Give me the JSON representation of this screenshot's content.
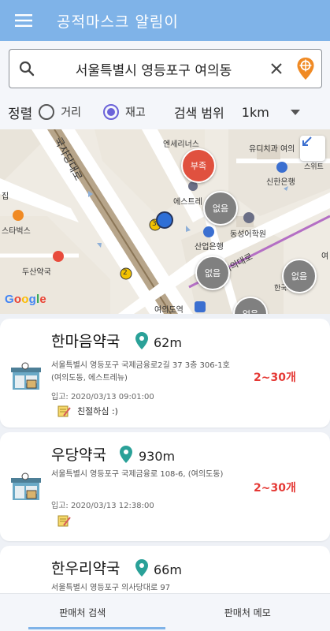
{
  "app": {
    "title": "공적마스크 알림이"
  },
  "colors": {
    "accent": "#7fb3e8",
    "radio_on": "#6c63d9",
    "stock_red": "#e53935",
    "empty_gray": "#808080",
    "low_red": "#e0513f",
    "pin_green": "#2aa198"
  },
  "search": {
    "value": "서울특별시 영등포구 여의동",
    "icon": "search-icon",
    "clear_icon": "close-icon",
    "location_icon": "location-pin-icon"
  },
  "filter": {
    "sort_label": "정렬",
    "options": [
      {
        "label": "거리",
        "selected": false
      },
      {
        "label": "재고",
        "selected": true
      }
    ],
    "radius_label": "검색 범위",
    "radius_value": "1km"
  },
  "map": {
    "labels": {
      "road1": "국사당대로",
      "road2": "여의대로",
      "enseries": "엔세리너스",
      "yudichi": "유디치과 여의",
      "suite": "스위트",
      "bank": "신한은행",
      "esteu": "에스트레",
      "dongseong": "동성어학원",
      "sanup": "산업은행",
      "starbucks": "스타벅스",
      "doosan": "두산약국",
      "subway": "여의도역",
      "hankook": "한국거래소",
      "jip": "집",
      "eo": "여"
    },
    "markers": [
      {
        "status": "low",
        "label": "부족"
      },
      {
        "status": "empty",
        "label": "없음"
      },
      {
        "status": "empty",
        "label": "없음"
      },
      {
        "status": "empty",
        "label": "없음"
      },
      {
        "status": "empty",
        "label": "없음"
      }
    ],
    "route_numbers": [
      "3",
      "2"
    ],
    "attribution": {
      "g1": "G",
      "o1": "o",
      "o2": "o",
      "g2": "g",
      "l": "l",
      "e": "e"
    }
  },
  "pharmacies": [
    {
      "name": "한마음약국",
      "distance": "62m",
      "address": "서울특별시 영등포구 국제금융로2길 37 3층 306-1호 (여의도동, 에스트레뉴)",
      "date": "입고: 2020/03/13 09:01:00",
      "note": "친절하심 :)",
      "stock": "2~30개"
    },
    {
      "name": "우당약국",
      "distance": "930m",
      "address": "서울특별시 영등포구 국제금융로 108-6, (여의도동)",
      "date": "입고: 2020/03/13 12:38:00",
      "note": "",
      "stock": "2~30개"
    },
    {
      "name": "한우리약국",
      "distance": "66m",
      "address": "서울특별시 영등포구 의사당대로 97",
      "date": "",
      "note": "",
      "stock": ""
    }
  ],
  "bottom_nav": [
    {
      "label": "판매처 검색",
      "active": true
    },
    {
      "label": "판매처 메모",
      "active": false
    }
  ]
}
